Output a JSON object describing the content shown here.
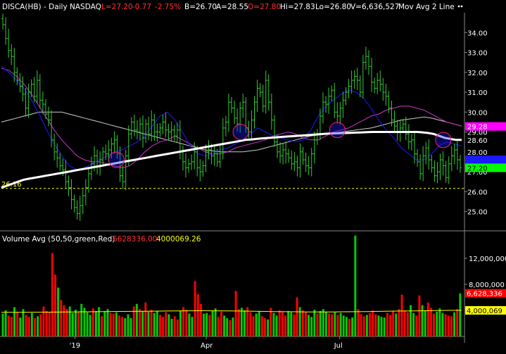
{
  "header": {
    "symbol": "DISCA(HB) - Daily  NASDAQ",
    "last": "L=27.20",
    "change": "-0.77",
    "change_pct": "-2.75%",
    "bid": "B=26.70",
    "ask": "A=28.55",
    "open": "O=27.80",
    "high": "Hi=27.83",
    "low": "Lo=26.80",
    "volume": "V=6,636,527",
    "study": "Mov Avg 2 Line",
    "menu_icon": "dots-icon"
  },
  "colors": {
    "background": "#000000",
    "candle": "#33cc33",
    "ma_fast": "#ffffff",
    "ma_mid": "#1a1aff",
    "ma_slow": "#cc33cc",
    "ma_long": "#cccccc",
    "support": "#ffff00",
    "vol_up": "#00cc00",
    "vol_down": "#ff0000",
    "vol_avg": "#ffff00"
  },
  "chart_data": [
    {
      "type": "line",
      "title": "DISCA(HB) - Daily  NASDAQ",
      "x_labels": [
        "'19",
        "Apr",
        "Jul"
      ],
      "ylim": [
        24.1,
        35.0
      ],
      "y_ticks": [
        25.0,
        26.0,
        27.0,
        28.0,
        29.0,
        30.0,
        31.0,
        32.0,
        33.0,
        34.0
      ],
      "price_badges": [
        {
          "label": "29.28",
          "value": 29.28,
          "color": "#ff00ff",
          "text_color": "#ffffff"
        },
        {
          "label": "28.60",
          "value": 28.6,
          "color": "#000000",
          "text_color": "#ffffff"
        },
        {
          "label": "28.00",
          "value": 28.0,
          "color": "#000000",
          "text_color": "#ffffff"
        },
        {
          "label": "",
          "value": 27.6,
          "color": "#1a1aff",
          "text_color": "#ffffff"
        },
        {
          "label": "27.20",
          "value": 27.2,
          "color": "#00ff00",
          "text_color": "#000000"
        }
      ],
      "support_line": {
        "label": "26.16",
        "value": 26.16
      },
      "series": [
        {
          "name": "close",
          "color": "#33cc33",
          "values": [
            34.4,
            33.7,
            33.1,
            32.8,
            32.0,
            31.6,
            31.3,
            30.9,
            30.2,
            31.0,
            31.4,
            30.8,
            31.6,
            30.6,
            30.4,
            29.9,
            29.6,
            28.6,
            28.0,
            27.7,
            27.3,
            27.1,
            26.5,
            26.2,
            25.6,
            25.2,
            24.9,
            25.3,
            25.8,
            26.2,
            26.9,
            27.4,
            27.8,
            27.3,
            27.6,
            28.0,
            27.9,
            28.1,
            28.4,
            28.6,
            27.9,
            26.8,
            26.5,
            27.8,
            28.9,
            29.5,
            29.1,
            29.0,
            29.4,
            28.7,
            29.4,
            28.9,
            29.6,
            29.0,
            29.0,
            29.2,
            29.5,
            29.1,
            29.0,
            29.1,
            28.8,
            29.1,
            28.0,
            27.5,
            27.2,
            27.4,
            27.5,
            28.0,
            27.2,
            27.0,
            27.3,
            28.0,
            28.1,
            27.8,
            27.9,
            27.5,
            28.0,
            29.2,
            29.5,
            30.5,
            30.2,
            29.7,
            29.4,
            30.2,
            30.5,
            29.2,
            29.0,
            29.6,
            30.5,
            31.2,
            31.0,
            30.3,
            31.6,
            30.5,
            29.6,
            28.5,
            28.0,
            27.8,
            28.1,
            27.9,
            27.7,
            27.4,
            27.5,
            27.2,
            28.0,
            27.6,
            27.3,
            27.2,
            27.9,
            28.6,
            28.9,
            29.8,
            30.5,
            30.4,
            30.8,
            31.1,
            30.0,
            29.8,
            30.2,
            30.6,
            31.0,
            31.3,
            31.6,
            31.8,
            31.6,
            31.0,
            32.5,
            32.8,
            32.3,
            31.5,
            31.2,
            31.6,
            31.4,
            31.0,
            30.8,
            30.2,
            29.6,
            29.3,
            29.0,
            29.2,
            29.4,
            28.9,
            28.5,
            28.6,
            27.9,
            27.5,
            26.9,
            27.8,
            28.2,
            27.6,
            27.2,
            26.8,
            27.0,
            27.6,
            27.3,
            26.7,
            27.4,
            27.8,
            28.1,
            27.6,
            27.2
          ]
        },
        {
          "name": "",
          "color": "#ffffff",
          "values": [
            26.2,
            26.3,
            26.4,
            26.5,
            26.6,
            26.65,
            26.7,
            26.75,
            26.8,
            26.85,
            26.9,
            26.95,
            27.0,
            27.05,
            27.1,
            27.15,
            27.2,
            27.25,
            27.3,
            27.35,
            27.4,
            27.45,
            27.5,
            27.55,
            27.6,
            27.65,
            27.7,
            27.75,
            27.8,
            27.85,
            27.9,
            27.95,
            28.0,
            28.05,
            28.1,
            28.15,
            28.2,
            28.25,
            28.3,
            28.35,
            28.4,
            28.45,
            28.5,
            28.55,
            28.6,
            28.62,
            28.65,
            28.68,
            28.7,
            28.72,
            28.74,
            28.76,
            28.78,
            28.8,
            28.82,
            28.84,
            28.86,
            28.88,
            28.9,
            28.92,
            28.93,
            28.94,
            28.95,
            28.96,
            28.97,
            28.98,
            28.99,
            29.0,
            29.0,
            29.0,
            29.0,
            29.0,
            29.0,
            29.0,
            29.0,
            29.0,
            28.98,
            28.95,
            28.9,
            28.8,
            28.7,
            28.65,
            28.6,
            28.6
          ]
        },
        {
          "name": "",
          "color": "#1a1aff",
          "values": [
            32.3,
            32.0,
            31.6,
            31.2,
            30.6,
            29.9,
            29.1,
            28.4,
            27.8,
            27.3,
            27.1,
            27.2,
            27.4,
            27.6,
            27.8,
            28.0,
            28.1,
            28.3,
            28.5,
            28.8,
            29.3,
            29.8,
            30.0,
            29.6,
            29.0,
            28.3,
            27.9,
            27.8,
            27.9,
            28.1,
            28.2,
            28.4,
            28.6,
            28.9,
            29.2,
            29.0,
            28.8,
            28.7,
            28.6,
            28.5,
            28.6,
            29.1,
            29.8,
            30.3,
            30.6,
            30.9,
            31.1,
            31.0,
            30.7,
            30.2,
            29.6,
            29.1,
            28.7,
            28.2,
            27.9,
            27.6,
            27.6,
            27.9,
            28.3,
            28.5,
            28.4,
            28.3
          ]
        },
        {
          "name": "",
          "color": "#cc33cc",
          "values": [
            32.2,
            32.1,
            31.8,
            31.4,
            30.9,
            30.3,
            29.7,
            29.1,
            28.6,
            28.2,
            27.8,
            27.6,
            27.5,
            27.5,
            27.4,
            27.3,
            27.2,
            27.3,
            27.6,
            28.0,
            28.3,
            28.5,
            28.6,
            28.8,
            28.6,
            28.4,
            28.2,
            28.0,
            27.9,
            27.9,
            28.0,
            28.2,
            28.3,
            28.4,
            28.5,
            28.6,
            28.8,
            28.9,
            29.0,
            28.9,
            28.7,
            28.6,
            28.6,
            28.8,
            29.0,
            29.1,
            29.2,
            29.4,
            29.6,
            29.8,
            29.9,
            30.1,
            30.2,
            30.3,
            30.3,
            30.2,
            30.1,
            29.9,
            29.7,
            29.5,
            29.4,
            29.3
          ]
        },
        {
          "name": "",
          "color": "#cccccc",
          "values": [
            29.5,
            29.6,
            29.7,
            29.8,
            29.9,
            30.0,
            30.0,
            30.0,
            30.0,
            29.9,
            29.8,
            29.7,
            29.6,
            29.5,
            29.4,
            29.3,
            29.2,
            29.1,
            29.0,
            28.9,
            28.8,
            28.7,
            28.6,
            28.5,
            28.4,
            28.3,
            28.2,
            28.1,
            28.05,
            28.0,
            28.0,
            28.0,
            28.0,
            28.05,
            28.1,
            28.2,
            28.3,
            28.4,
            28.5,
            28.6,
            28.7,
            28.8,
            28.85,
            28.9,
            28.95,
            29.0,
            29.05,
            29.1,
            29.15,
            29.2,
            29.3,
            29.4,
            29.5,
            29.6,
            29.65,
            29.7,
            29.75,
            29.7,
            29.6,
            29.5,
            29.4,
            29.3
          ]
        }
      ],
      "circle_annotations": [
        {
          "x_frac": 0.25,
          "y": 27.6,
          "label": "",
          "color": "#1a1aff"
        },
        {
          "x_frac": 0.52,
          "y": 29.0,
          "label": "",
          "color": "#1a1aff"
        },
        {
          "x_frac": 0.73,
          "y": 29.1,
          "label": "",
          "color": "#1a1aff"
        },
        {
          "x_frac": 0.96,
          "y": 28.6,
          "label": "",
          "color": "#1a1aff"
        }
      ]
    },
    {
      "type": "bar",
      "title": "Volume Avg (50,50,green,Red)",
      "legend": [
        {
          "label": "6628336.00",
          "color": "#ff3333"
        },
        {
          "label": "4000069.26",
          "color": "#ffff00"
        }
      ],
      "ylim": [
        0,
        16000000
      ],
      "y_ticks": [
        {
          "label": "12,000,000",
          "value": 12000000
        },
        {
          "label": "8,000,000",
          "value": 8000000
        }
      ],
      "badges": [
        {
          "label": "6,628,336",
          "value": 6628336,
          "color": "#ff0000",
          "text_color": "#ffffff"
        },
        {
          "label": "4,000,069",
          "value": 4000069,
          "color": "#ffff00",
          "text_color": "#000000"
        }
      ],
      "values": [
        3500000,
        4000000,
        3200000,
        3000000,
        4500000,
        3800000,
        2900000,
        4200000,
        3300000,
        3000000,
        3600000,
        2800000,
        3100000,
        3400000,
        4600000,
        3900000,
        3700000,
        12800000,
        9500000,
        7500000,
        5600000,
        4800000,
        4200000,
        4600000,
        3600000,
        4100000,
        3800000,
        5000000,
        4400000,
        3700000,
        3300000,
        4300000,
        3900000,
        4500000,
        3100000,
        3900000,
        4200000,
        3600000,
        3500000,
        3700000,
        3200000,
        3000000,
        2800000,
        3400000,
        2800000,
        4600000,
        5000000,
        4200000,
        3900000,
        5200000,
        3800000,
        4100000,
        3600000,
        3900000,
        3300000,
        3000000,
        3700000,
        3400000,
        2700000,
        3100000,
        2600000,
        3900000,
        4500000,
        4100000,
        3500000,
        3000000,
        8500000,
        6500000,
        5000000,
        3500000,
        3600000,
        3300000,
        3900000,
        4300000,
        3000000,
        3800000,
        3200000,
        2800000,
        2500000,
        2900000,
        7000000,
        4200000,
        4400000,
        4000000,
        4500000,
        3700000,
        3100000,
        3500000,
        3900000,
        3100000,
        2800000,
        2600000,
        4400000,
        3600000,
        3200000,
        4000000,
        3800000,
        3200000,
        3900000,
        3700000,
        3400000,
        6000000,
        4500000,
        4000000,
        3700000,
        3300000,
        3000000,
        4100000,
        3500000,
        3900000,
        4200000,
        3800000,
        3500000,
        3400000,
        3700000,
        3300000,
        3600000,
        3200000,
        3000000,
        2700000,
        2900000,
        15500000,
        4200000,
        3400000,
        3100000,
        3300000,
        3600000,
        4000000,
        3400000,
        3200000,
        3000000,
        2900000,
        3600000,
        3300000,
        3900000,
        3500000,
        4200000,
        6400000,
        4000000,
        3700000,
        4800000,
        3600000,
        3200000,
        6300000,
        4800000,
        4000000,
        5200000,
        4400000,
        3500000,
        3800000,
        4300000,
        3600000,
        3400000,
        3200000,
        3100000,
        3700000,
        4200000,
        6600000
      ],
      "up": [
        1,
        1,
        0,
        0,
        1,
        0,
        1,
        1,
        0,
        0,
        1,
        0,
        1,
        0,
        0,
        0,
        0,
        0,
        0,
        1,
        0,
        0,
        0,
        1,
        1,
        1,
        0,
        1,
        1,
        1,
        1,
        0,
        1,
        1,
        0,
        1,
        1,
        0,
        0,
        1,
        0,
        0,
        1,
        1,
        1,
        0,
        1,
        0,
        1,
        0,
        1,
        0,
        1,
        1,
        0,
        0,
        0,
        1,
        1,
        0,
        0,
        1,
        0,
        0,
        1,
        1,
        0,
        0,
        0,
        1,
        1,
        0,
        1,
        1,
        0,
        0,
        1,
        1,
        0,
        1,
        0,
        0,
        1,
        1,
        0,
        0,
        0,
        1,
        1,
        0,
        0,
        1,
        0,
        1,
        1,
        0,
        0,
        0,
        1,
        1,
        0,
        0,
        1,
        0,
        0,
        1,
        1,
        1,
        0,
        1,
        1,
        1,
        0,
        0,
        1,
        0,
        1,
        1,
        1,
        0,
        1,
        1,
        0,
        0,
        0,
        1,
        0,
        0,
        0,
        1,
        1,
        1,
        0,
        0,
        0,
        1,
        0,
        0,
        0,
        0,
        1,
        1,
        0,
        0,
        1,
        1,
        0,
        0,
        0,
        1,
        1,
        1,
        0,
        0,
        0,
        1,
        0,
        1,
        0,
        1,
        0
      ],
      "avg": [
        3700000,
        3700000,
        3710000,
        3720000,
        3730000,
        3740000,
        3760000,
        3780000,
        3800000,
        3820000,
        3840000,
        3850000,
        3870000,
        3880000,
        3900000,
        3920000,
        3940000,
        3950000,
        3940000,
        3920000,
        3900000,
        3880000,
        3850000,
        3820000,
        3800000,
        3780000,
        3760000,
        3750000,
        3760000,
        3780000,
        3800000,
        3820000,
        3850000,
        3880000,
        3900000,
        3920000,
        3950000,
        3980000,
        4000000,
        4000000
      ]
    }
  ]
}
